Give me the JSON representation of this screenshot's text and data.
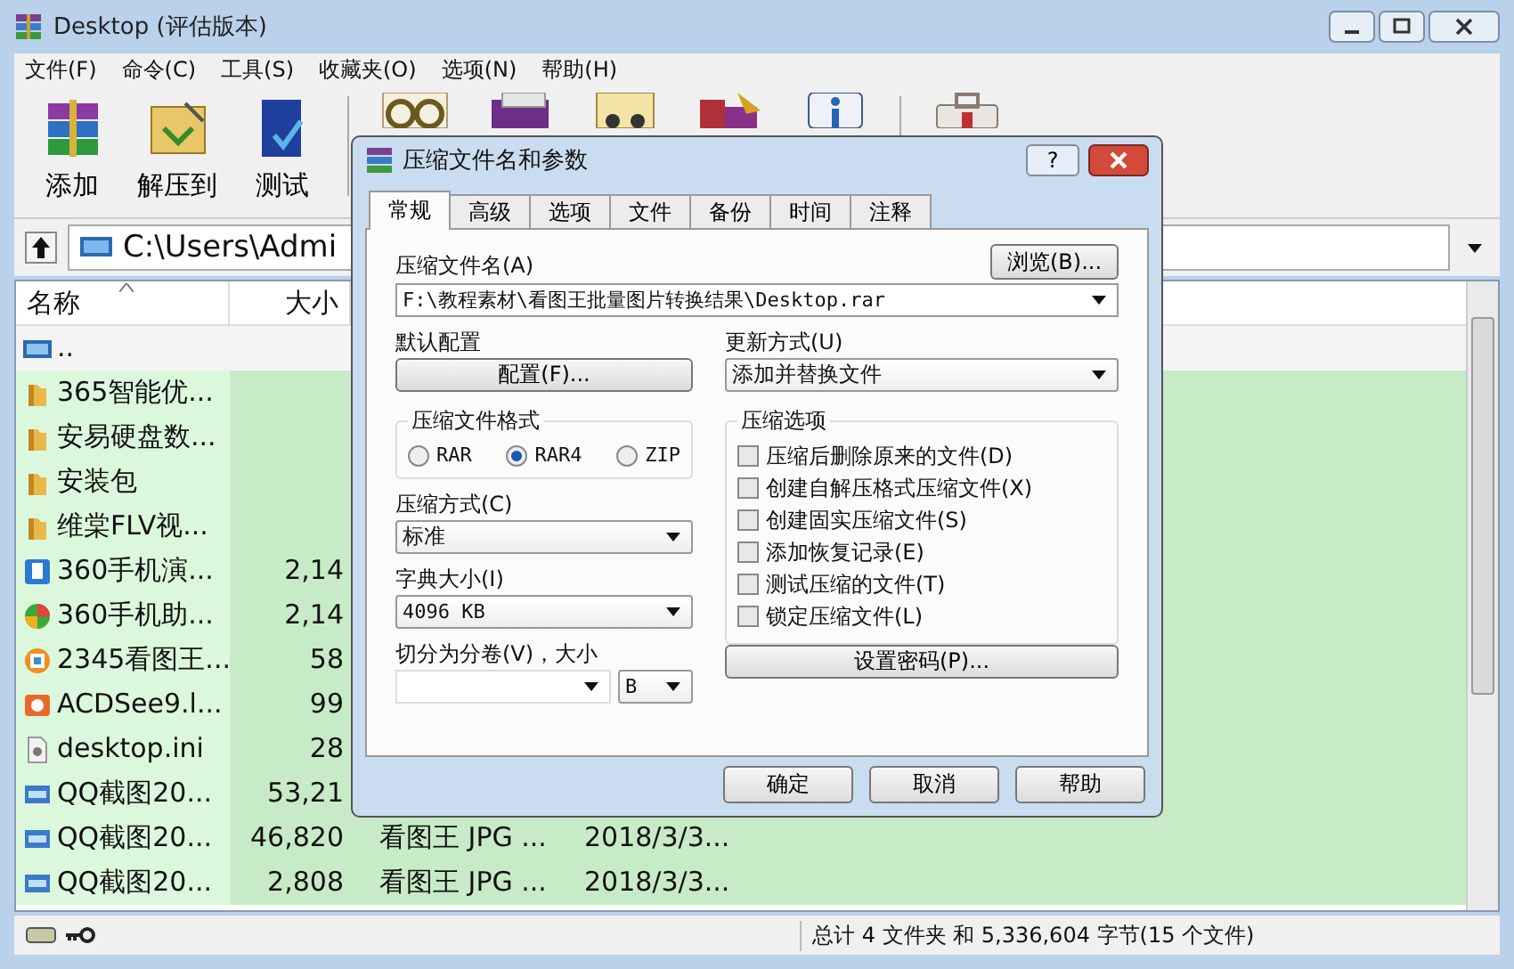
{
  "window": {
    "title": "Desktop (评估版本)"
  },
  "menu": [
    "文件(F)",
    "命令(C)",
    "工具(S)",
    "收藏夹(O)",
    "选项(N)",
    "帮助(H)"
  ],
  "toolbar": {
    "groups": [
      [
        {
          "kind": "add",
          "label": "添加"
        },
        {
          "kind": "extract",
          "label": "解压到"
        },
        {
          "kind": "test",
          "label": "测试"
        }
      ],
      [
        {
          "kind": "view"
        },
        {
          "kind": "delete"
        },
        {
          "kind": "find"
        },
        {
          "kind": "wizard"
        },
        {
          "kind": "info"
        }
      ],
      [
        {
          "kind": "repair"
        }
      ]
    ]
  },
  "address": {
    "path": "C:\\Users\\Admi"
  },
  "file_list": {
    "columns": [
      {
        "label": "名称",
        "sorted": true
      },
      {
        "label": "大小",
        "sorted": false
      }
    ],
    "rows": [
      {
        "kind": "up",
        "name": ".."
      },
      {
        "kind": "folder",
        "name": "365智能优..."
      },
      {
        "kind": "folder",
        "name": "安易硬盘数..."
      },
      {
        "kind": "folder",
        "name": "安装包"
      },
      {
        "kind": "folder",
        "name": "维棠FLV视..."
      },
      {
        "kind": "phone",
        "name": "360手机演...",
        "size": "2,14"
      },
      {
        "kind": "ball",
        "name": "360手机助...",
        "size": "2,14"
      },
      {
        "kind": "viewer",
        "name": "2345看图王...",
        "size": "58"
      },
      {
        "kind": "camera",
        "name": "ACDSee9.l...",
        "size": "99"
      },
      {
        "kind": "ini",
        "name": "desktop.ini",
        "size": "28"
      },
      {
        "kind": "jpg",
        "name": "QQ截图20...",
        "size": "53,21"
      },
      {
        "kind": "jpg",
        "name": "QQ截图20...",
        "size": "46,820",
        "type": "看图王 JPG ...",
        "date": "2018/3/3..."
      },
      {
        "kind": "jpg",
        "name": "QQ截图20...",
        "size": "2,808",
        "type": "看图王 JPG ...",
        "date": "2018/3/3..."
      }
    ]
  },
  "status_bar": {
    "summary": "总计 4 文件夹 和 5,336,604 字节(15 个文件)"
  },
  "dialog": {
    "title": "压缩文件名和参数",
    "help_glyph": "?",
    "tabs": [
      {
        "label": "常规",
        "selected": true
      },
      {
        "label": "高级",
        "selected": false
      },
      {
        "label": "选项",
        "selected": false
      },
      {
        "label": "文件",
        "selected": false
      },
      {
        "label": "备份",
        "selected": false
      },
      {
        "label": "时间",
        "selected": false
      },
      {
        "label": "注释",
        "selected": false
      }
    ],
    "archive_name_label": "压缩文件名(A)",
    "browse_button": "浏览(B)...",
    "archive_name": "F:\\教程素材\\看图王批量图片转换结果\\Desktop.rar",
    "profile_label": "默认配置",
    "profile_button": "配置(F)...",
    "update_label": "更新方式(U)",
    "update_mode": "添加并替换文件",
    "format_group": {
      "title": "压缩文件格式",
      "options": [
        {
          "label": "RAR",
          "selected": false
        },
        {
          "label": "RAR4",
          "selected": true
        },
        {
          "label": "ZIP",
          "selected": false
        }
      ]
    },
    "options_group": {
      "title": "压缩选项",
      "options": [
        {
          "label": "压缩后删除原来的文件(D)",
          "checked": false
        },
        {
          "label": "创建自解压格式压缩文件(X)",
          "checked": false
        },
        {
          "label": "创建固实压缩文件(S)",
          "checked": false
        },
        {
          "label": "添加恢复记录(E)",
          "checked": false
        },
        {
          "label": "测试压缩的文件(T)",
          "checked": false
        },
        {
          "label": "锁定压缩文件(L)",
          "checked": false
        }
      ]
    },
    "method_label": "压缩方式(C)",
    "method": "标准",
    "dictionary_label": "字典大小(I)",
    "dictionary": "4096 KB",
    "split_label": "切分为分卷(V)，大小",
    "split_unit": "B",
    "password_button": "设置密码(P)...",
    "buttons": [
      "确定",
      "取消",
      "帮助"
    ]
  }
}
